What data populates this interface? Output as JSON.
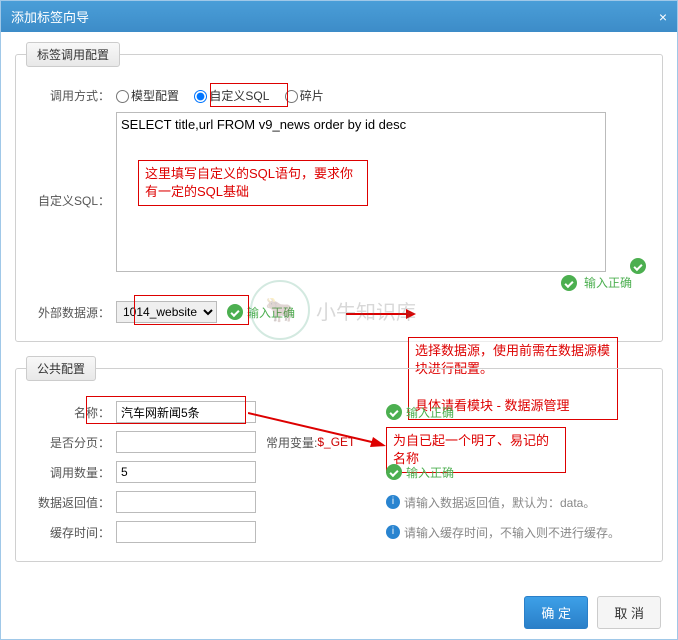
{
  "dialog": {
    "title": "添加标签向导",
    "close": "×"
  },
  "fs1": {
    "legend": "标签调用配置",
    "mode_label": "调用方式：",
    "mode_opts": {
      "a": "模型配置",
      "b": "自定义SQL",
      "c": "碎片"
    },
    "sql_label": "自定义SQL：",
    "sql_value": "SELECT title,url FROM v9_news order by id desc",
    "ds_label": "外部数据源：",
    "ds_value": "1014_website",
    "ok": "输入正确"
  },
  "fs2": {
    "legend": "公共配置",
    "name_label": "名称：",
    "name_value": "汽车网新闻5条",
    "page_label": "是否分页：",
    "page_vars": "常用变量:",
    "page_vars_val": "$_GET",
    "num_label": "调用数量：",
    "num_value": "5",
    "ret_label": "数据返回值：",
    "ret_hint": "请输入数据返回值，默认为：data。",
    "cache_label": "缓存时间：",
    "cache_hint": "请输入缓存时间，不输入则不进行缓存。",
    "ok": "输入正确"
  },
  "anno": {
    "sql": "这里填写自定义的SQL语句，要求你有一定的SQL基础",
    "ds": "选择数据源，使用前需在数据源模块进行配置。\n\n具体请看模块 - 数据源管理",
    "name": "为自已起一个明了、易记的名称"
  },
  "footer": {
    "ok": "确 定",
    "cancel": "取 消"
  },
  "watermark": "小牛知识库"
}
